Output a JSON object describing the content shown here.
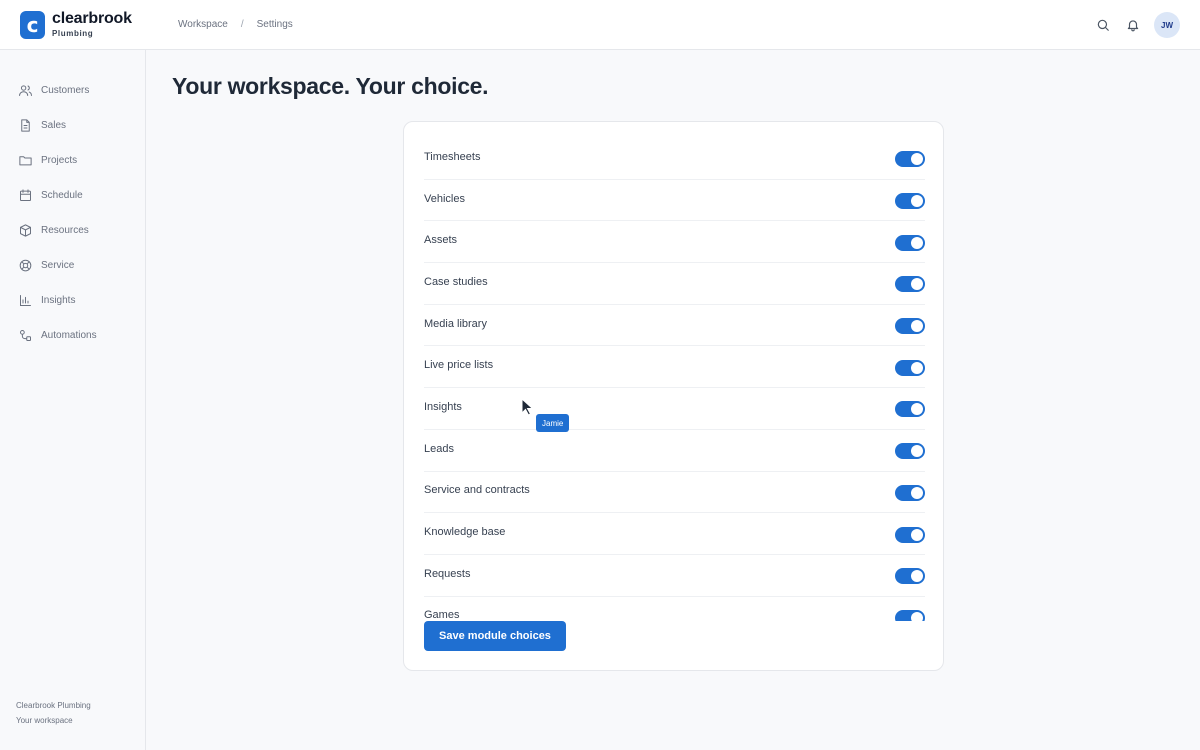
{
  "brand": {
    "name": "clearbrook",
    "subtitle": "Plumbing",
    "logo_letter": "c",
    "color": "#1f6fd1"
  },
  "breadcrumb": [
    "Workspace",
    "Settings"
  ],
  "header": {
    "avatar_initials": "JW",
    "icons": [
      "search-icon",
      "bell-icon"
    ]
  },
  "sidebar": {
    "items": [
      {
        "label": "Customers",
        "icon": "users-icon"
      },
      {
        "label": "Sales",
        "icon": "document-icon"
      },
      {
        "label": "Projects",
        "icon": "folder-icon"
      },
      {
        "label": "Schedule",
        "icon": "calendar-icon"
      },
      {
        "label": "Resources",
        "icon": "box-icon"
      },
      {
        "label": "Service",
        "icon": "lifebuoy-icon"
      },
      {
        "label": "Insights",
        "icon": "chart-icon"
      },
      {
        "label": "Automations",
        "icon": "workflow-icon"
      }
    ],
    "footer": {
      "company": "Clearbrook Plumbing",
      "workspace": "Your workspace"
    }
  },
  "main": {
    "title": "Your workspace. Your choice.",
    "modules": [
      {
        "label": "Timesheets",
        "enabled": true
      },
      {
        "label": "Vehicles",
        "enabled": true
      },
      {
        "label": "Assets",
        "enabled": true
      },
      {
        "label": "Case studies",
        "enabled": true
      },
      {
        "label": "Media library",
        "enabled": true
      },
      {
        "label": "Live price lists",
        "enabled": true
      },
      {
        "label": "Insights",
        "enabled": true
      },
      {
        "label": "Leads",
        "enabled": true
      },
      {
        "label": "Service and contracts",
        "enabled": true
      },
      {
        "label": "Knowledge base",
        "enabled": true
      },
      {
        "label": "Requests",
        "enabled": true
      },
      {
        "label": "Games",
        "enabled": true
      }
    ],
    "save_label": "Save module choices"
  },
  "cursor": {
    "tag": "Jamie"
  }
}
